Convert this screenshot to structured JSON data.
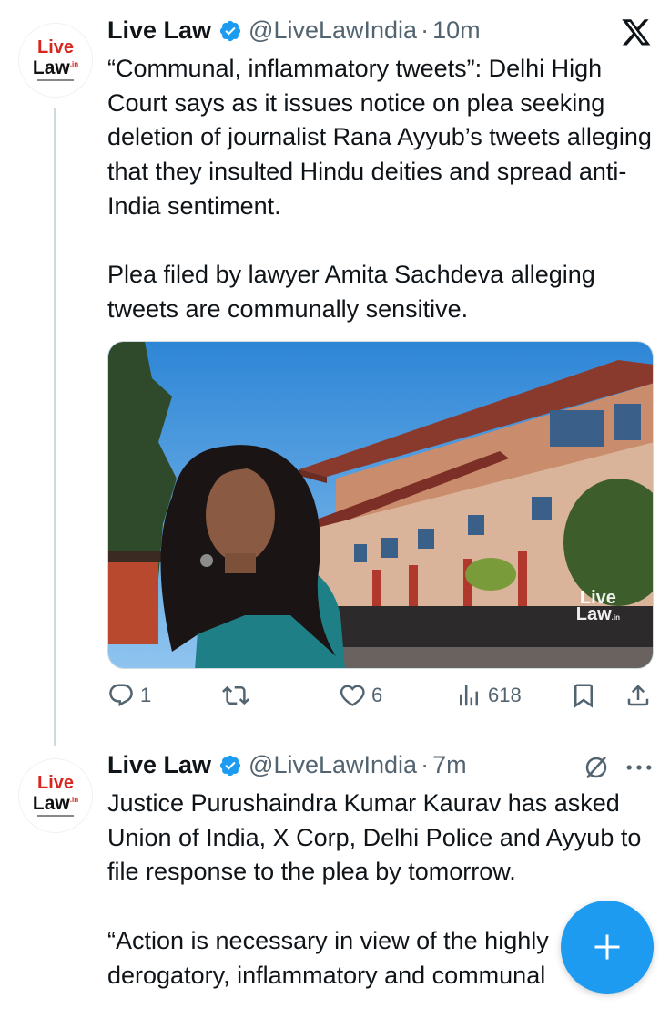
{
  "tweets": [
    {
      "author": "Live Law",
      "handle": "@LiveLawIndia",
      "separator": "·",
      "time": "10m",
      "paragraphs": [
        "“Communal, inflammatory tweets”: Delhi High Court says as it issues notice on plea seeking deletion of journalist Rana Ayyub’s tweets alleging that they insulted Hindu deities and spread anti-India sentiment.",
        "Plea filed by lawyer Amita Sachdeva alleging tweets are communally sensitive."
      ],
      "actions": {
        "replies": "1",
        "reposts": "",
        "likes": "6",
        "views": "618"
      }
    },
    {
      "author": "Live Law",
      "handle": "@LiveLawIndia",
      "separator": "·",
      "time": "7m",
      "paragraphs": [
        "Justice Purushaindra Kumar Kaurav has asked Union of India, X Corp, Delhi Police and Ayyub to file response to the plea by tomorrow.",
        "“Action is necessary in view of the highly derogatory, inflammatory and communal"
      ]
    }
  ],
  "avatar": {
    "line1": "Live",
    "line2": "Law",
    "suffix": ".in"
  },
  "watermark": {
    "line1": "Live",
    "line2": "Law",
    "suffix": ".in"
  },
  "icons": {
    "platform": "x-logo-icon",
    "verified": "verified-badge-icon",
    "reply": "reply-icon",
    "repost": "repost-icon",
    "like": "heart-icon",
    "views": "views-icon",
    "bookmark": "bookmark-icon",
    "share": "share-icon",
    "mute": "muted-icon",
    "more": "more-icon",
    "compose": "plus-icon"
  },
  "colors": {
    "accent": "#1d9bf0",
    "text": "#0f1419",
    "secondary": "#536471",
    "brand_red": "#d7261f"
  }
}
